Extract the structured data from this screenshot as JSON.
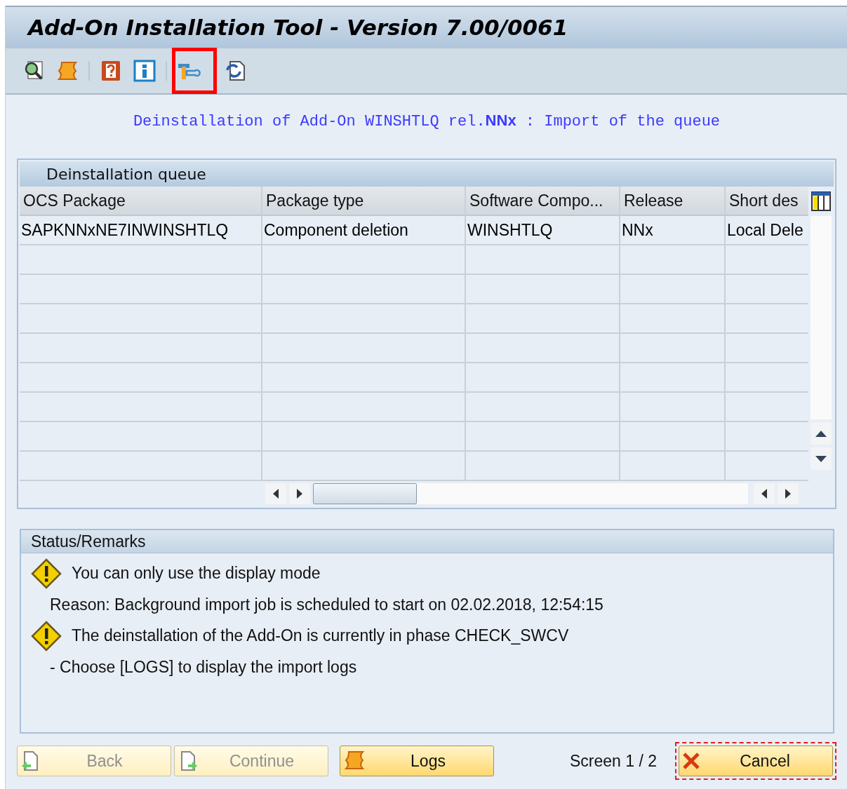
{
  "window": {
    "title": "Add-On Installation Tool - Version 7.00/0061"
  },
  "toolbar": [
    {
      "kind": "button",
      "highlighted": false
    },
    {
      "kind": "button",
      "highlighted": false
    },
    {
      "kind": "separator"
    },
    {
      "kind": "button",
      "highlighted": false
    },
    {
      "kind": "button",
      "highlighted": false
    },
    {
      "kind": "separator"
    },
    {
      "kind": "button",
      "highlighted": true
    },
    {
      "kind": "button",
      "highlighted": false
    }
  ],
  "heading": "Deinstallation of Add-On WINSHTLQ rel.**NNx** : Import of the queue",
  "queue": {
    "title": "Deinstallation queue",
    "columns": [
      "OCS Package",
      "Package type",
      "Software Compo...",
      "Release",
      "Short des"
    ],
    "rows": [
      [
        "SAPKNNxNE7INWINSHTLQ",
        "Component deletion",
        "WINSHTLQ",
        "NNx",
        "Local Dele"
      ]
    ]
  },
  "status": {
    "title": "Status/Remarks",
    "messages": [
      {
        "kind": "warning",
        "text": "You can only use the display mode"
      },
      {
        "kind": "text",
        "text": "Reason: Background import job is scheduled to start on 02.02.2018, 12:54:15"
      },
      {
        "kind": "warning",
        "text": "The deinstallation of the Add-On is currently in phase CHECK_SWCV"
      },
      {
        "kind": "text",
        "text": "- Choose [LOGS] to display the import logs"
      }
    ]
  },
  "footer": {
    "buttons": [
      {
        "label": "Back",
        "disabled": true
      },
      {
        "label": "Continue",
        "disabled": true
      },
      {
        "label": "Logs",
        "disabled": false
      }
    ],
    "screen": "Screen 1 / 2",
    "cancel": {
      "label": "Cancel",
      "focused": true
    }
  }
}
